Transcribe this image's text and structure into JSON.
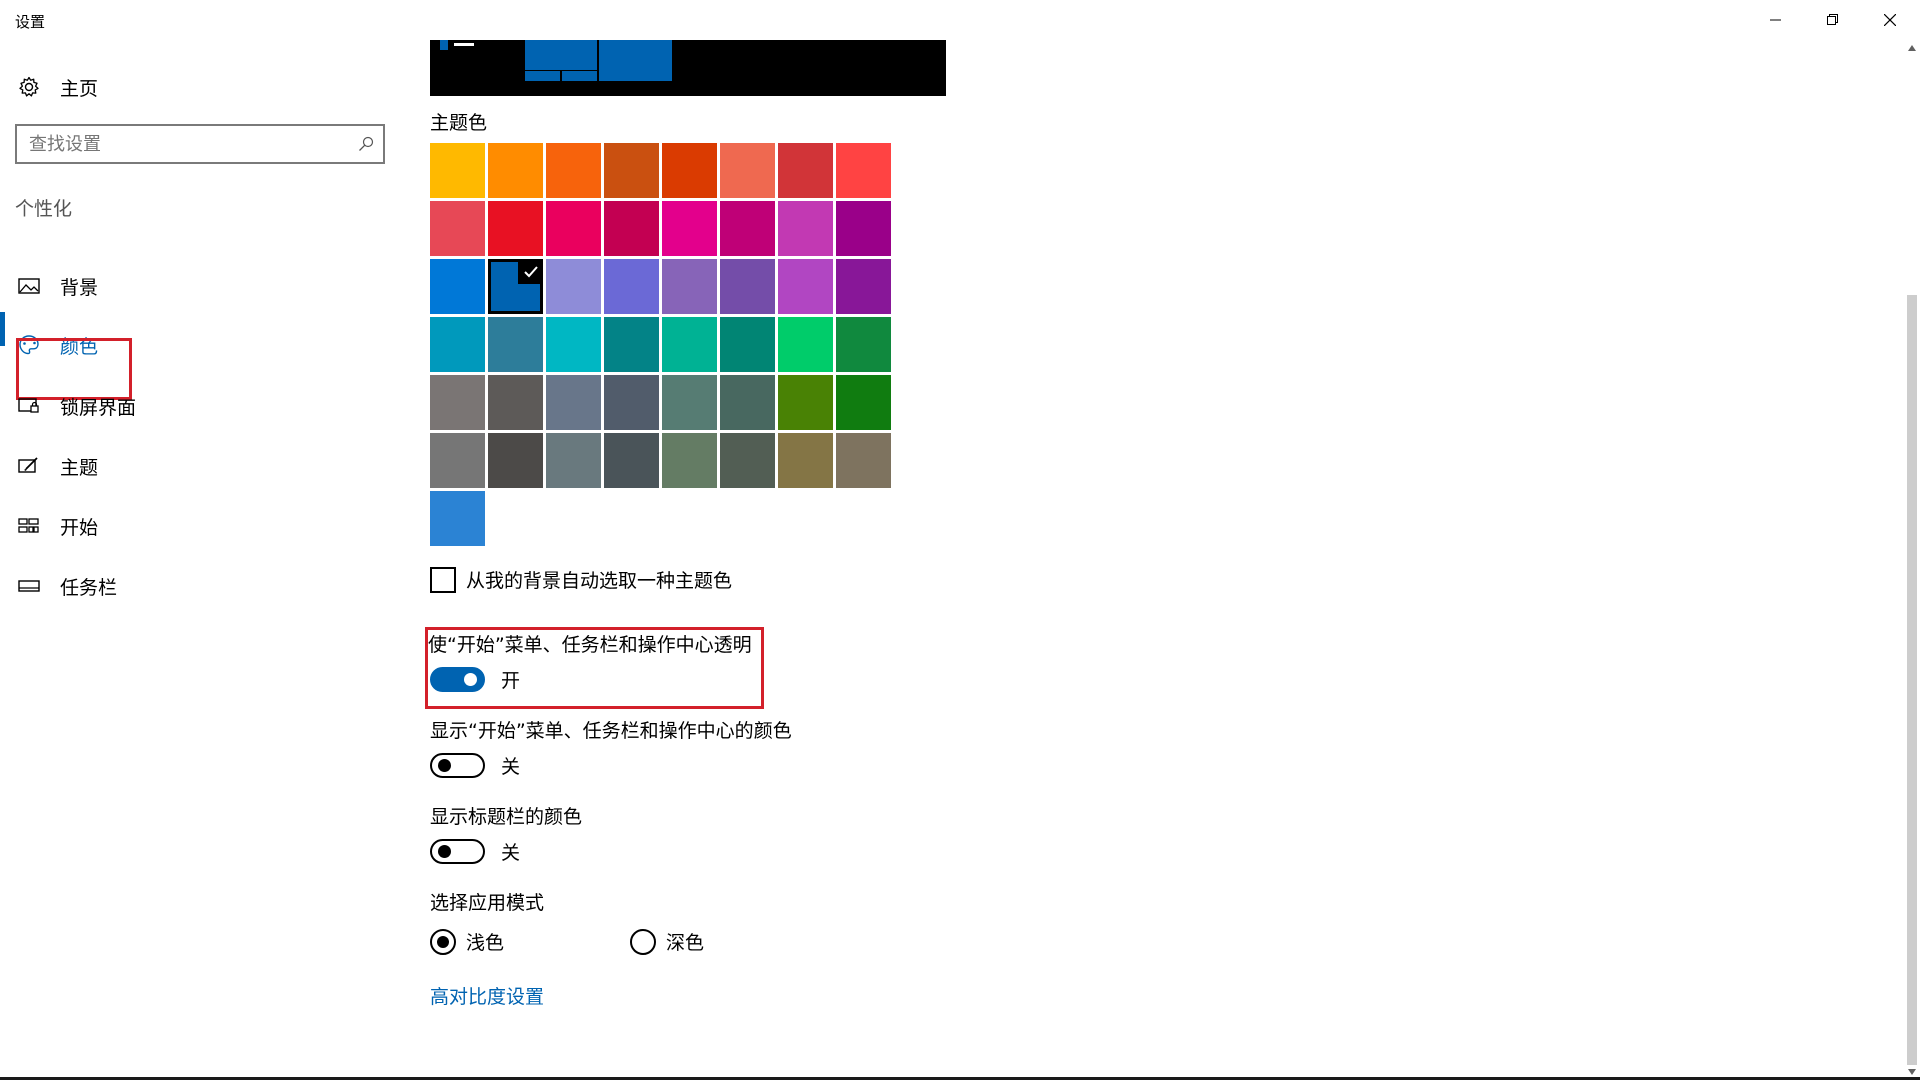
{
  "window": {
    "title": "设置",
    "controls": [
      "minimize",
      "restore",
      "close"
    ]
  },
  "sidebar": {
    "home_label": "主页",
    "home_icon": "gear-icon",
    "search_placeholder": "查找设置",
    "search_icon": "search-icon",
    "section_title": "个性化",
    "items": [
      {
        "label": "背景",
        "icon": "picture-icon",
        "active": false
      },
      {
        "label": "颜色",
        "icon": "palette-icon",
        "active": true
      },
      {
        "label": "锁屏界面",
        "icon": "lock-screen-icon",
        "active": false
      },
      {
        "label": "主题",
        "icon": "theme-brush-icon",
        "active": false
      },
      {
        "label": "开始",
        "icon": "start-tiles-icon",
        "active": false
      },
      {
        "label": "任务栏",
        "icon": "taskbar-icon",
        "active": false
      }
    ]
  },
  "main": {
    "accent_heading": "主题色",
    "accent_colors": [
      [
        "#FFB900",
        "#FF8C00",
        "#F7630C",
        "#CA5010",
        "#DA3B01",
        "#EF6950",
        "#D13438",
        "#FF4343"
      ],
      [
        "#E74856",
        "#E81123",
        "#EA005E",
        "#C30052",
        "#E3008C",
        "#BF0077",
        "#C239B3",
        "#9A0089"
      ],
      [
        "#0078D7",
        "#0063B1",
        "#8E8CD8",
        "#6B69D6",
        "#8764B8",
        "#744DA9",
        "#B146C2",
        "#881798"
      ],
      [
        "#0099BC",
        "#2D7D9A",
        "#00B7C3",
        "#038387",
        "#00B294",
        "#018574",
        "#00CC6A",
        "#10893E"
      ],
      [
        "#7A7574",
        "#5D5A58",
        "#68768A",
        "#515C6B",
        "#567C73",
        "#486860",
        "#498205",
        "#107C10"
      ],
      [
        "#767676",
        "#4C4A48",
        "#69797E",
        "#4A5459",
        "#647C64",
        "#525E54",
        "#847545",
        "#7E735F"
      ],
      [
        "#2B83D4"
      ]
    ],
    "selected_color": "#0063B1",
    "auto_pick_label": "从我的背景自动选取一种主题色",
    "auto_pick_checked": false,
    "transparency_heading": "使“开始”菜单、任务栏和操作中心透明",
    "transparency_state": "开",
    "show_color_heading": "显示“开始”菜单、任务栏和操作中心的颜色",
    "show_color_state": "关",
    "titlebar_color_heading": "显示标题栏的颜色",
    "titlebar_color_state": "关",
    "app_mode_heading": "选择应用模式",
    "mode_light": "浅色",
    "mode_dark": "深色",
    "mode_selected": "浅色",
    "high_contrast_link": "高对比度设置"
  }
}
